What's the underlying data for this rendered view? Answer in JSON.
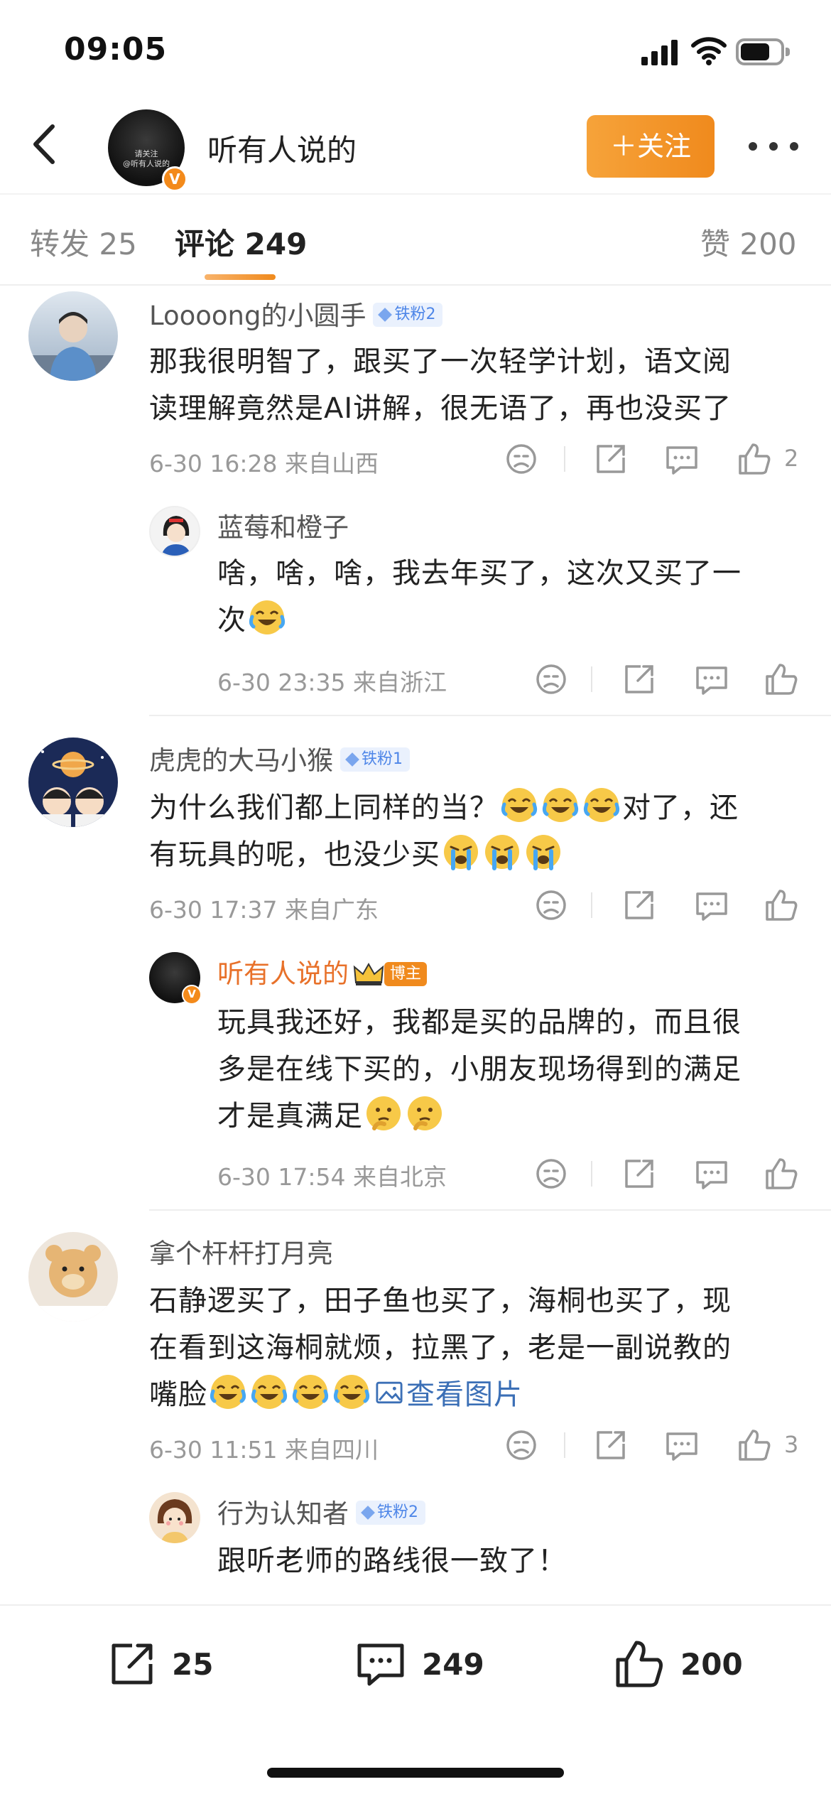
{
  "status_bar": {
    "time": "09:05"
  },
  "header": {
    "avatar_caption": "请关注\n@听有人说的",
    "verified_mark": "V",
    "name": "听有人说的",
    "follow_label": "＋关注"
  },
  "tabs": {
    "reposts": "转发 25",
    "comments": "评论 249",
    "likes": "赞 200"
  },
  "comments": [
    {
      "username": "Loooong的小圆手",
      "badge": "铁粉2",
      "text_line1": "那我很明智了，跟买了一次轻学计划，语文阅",
      "text_line2": "读理解竟然是AI讲解，很无语了，再也没买了",
      "meta": "6-30 16:28  来自山西",
      "like_count": "2",
      "reply": {
        "username": "蓝莓和橙子",
        "text_line1": "啥，啥，啥，我去年买了，这次又买了一",
        "text_line2": "次",
        "meta": "6-30 23:35  来自浙江"
      }
    },
    {
      "username": "虎虎的大马小猴",
      "badge": "铁粉1",
      "text_line1a": "为什么我们都上同样的当？",
      "text_line1b": "对了，还",
      "text_line2a": "有玩具的呢，也没少买",
      "meta": "6-30 17:37  来自广东",
      "reply": {
        "username": "听有人说的",
        "badge": "博主",
        "text_line1": "玩具我还好，我都是买的品牌的，而且很",
        "text_line2": "多是在线下买的，小朋友现场得到的满足",
        "text_line3": "才是真满足",
        "meta": "6-30 17:54  来自北京"
      }
    },
    {
      "username": "拿个杆杆打月亮",
      "text_line1": "石静逻买了，田子鱼也买了，海桐也买了，现",
      "text_line2": "在看到这海桐就烦，拉黑了，老是一副说教的",
      "text_line3a": "嘴脸",
      "view_image": "查看图片",
      "meta": "6-30 11:51  来自四川",
      "like_count": "3",
      "reply": {
        "username": "行为认知者",
        "badge": "铁粉2",
        "text_line1": "跟听老师的路线很一致了！"
      }
    }
  ],
  "bottom_bar": {
    "repost_count": "25",
    "comment_count": "249",
    "like_count": "200"
  },
  "colors": {
    "accent": "#f08a1d",
    "link": "#3b6fb6",
    "fan_badge": "#4e86e8"
  }
}
